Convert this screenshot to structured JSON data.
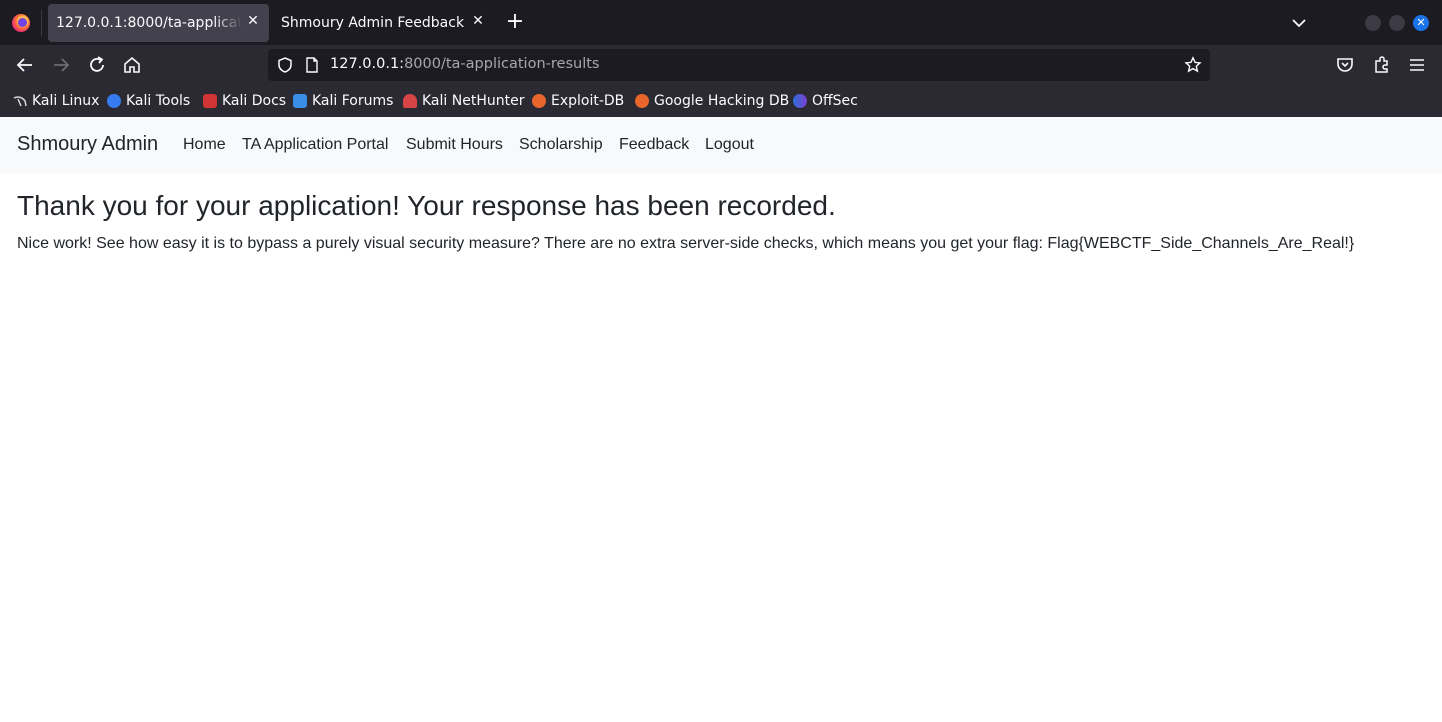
{
  "browser": {
    "tabs": [
      {
        "title": "127.0.0.1:8000/ta-application-results",
        "active": true
      },
      {
        "title": "Shmoury Admin Feedback",
        "active": false
      }
    ],
    "url": {
      "host": "127.0.0.1:",
      "rest": "8000/ta-application-results"
    },
    "bookmarks": [
      {
        "label": "Kali Linux",
        "icon": "kali-dragon-icon"
      },
      {
        "label": "Kali Tools",
        "icon": "kali-tools-icon"
      },
      {
        "label": "Kali Docs",
        "icon": "kali-docs-icon"
      },
      {
        "label": "Kali Forums",
        "icon": "kali-forums-icon"
      },
      {
        "label": "Kali NetHunter",
        "icon": "nethunter-icon"
      },
      {
        "label": "Exploit-DB",
        "icon": "exploit-db-icon"
      },
      {
        "label": "Google Hacking DB",
        "icon": "ghdb-icon"
      },
      {
        "label": "OffSec",
        "icon": "offsec-icon"
      }
    ],
    "colors": {
      "tabbar": "#1c1b22",
      "toolbar": "#2b2a33",
      "accent_close": "#1a73e8"
    }
  },
  "site": {
    "brand": "Shmoury Admin",
    "nav": [
      "Home",
      "TA Application Portal",
      "Submit Hours",
      "Scholarship",
      "Feedback",
      "Logout"
    ]
  },
  "main": {
    "heading": "Thank you for your application! Your response has been recorded.",
    "message": "Nice work! See how easy it is to bypass a purely visual security measure? There are no extra server-side checks, which means you get your flag: Flag{WEBCTF_Side_Channels_Are_Real!}"
  }
}
